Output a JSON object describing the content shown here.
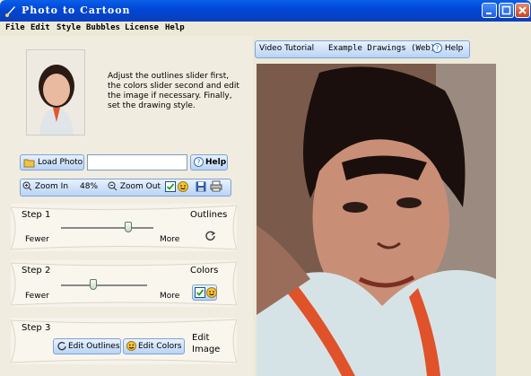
{
  "window": {
    "title": "Photo to Cartoon"
  },
  "menu": [
    "File",
    "Edit",
    "Style",
    "Bubbles",
    "License",
    "Help"
  ],
  "instructions": "Adjust the outlines slider first, the colors slider second and edit the image if necessary. Finally, set the drawing style.",
  "load": {
    "button": "Load Photo",
    "path_value": "",
    "help": "Help"
  },
  "zoom": {
    "in_label": "Zoom In",
    "level": "48%",
    "out_label": "Zoom Out"
  },
  "step1": {
    "title": "Step 1",
    "right_label": "Outlines",
    "min_label": "Fewer",
    "max_label": "More",
    "value_fraction": 0.73
  },
  "step2": {
    "title": "Step 2",
    "right_label": "Colors",
    "min_label": "Fewer",
    "max_label": "More",
    "value_fraction": 0.38
  },
  "step3": {
    "title": "Step 3",
    "edit_outlines": "Edit Outlines",
    "edit_colors": "Edit Colors",
    "right_label": "Edit Image"
  },
  "top_toolbar": {
    "video": "Video Tutorial",
    "examples": "Example Drawings (Web)",
    "help": "Help"
  },
  "colors": {
    "titlebar": "#0a5fe8",
    "panel": "#f0ece0",
    "canvas_bg": "#6b4a3a"
  }
}
